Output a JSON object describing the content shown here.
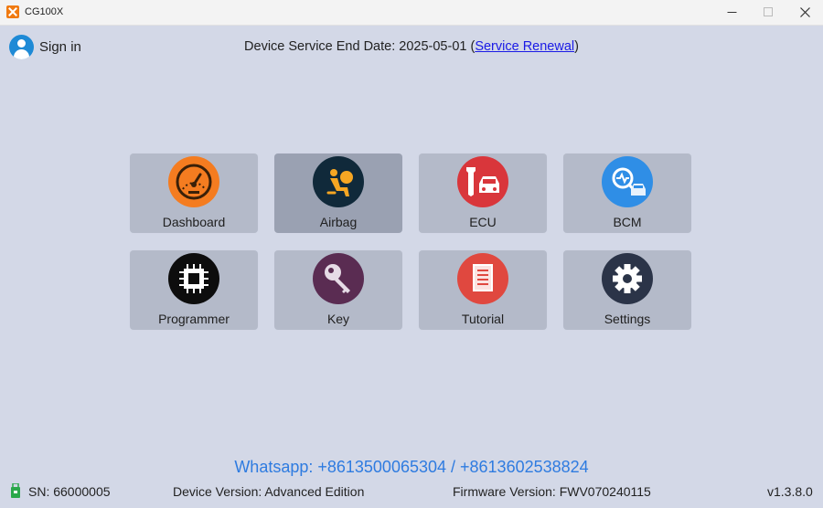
{
  "window": {
    "title": "CG100X",
    "controls": [
      "minimize-icon",
      "maximize-icon",
      "close-icon"
    ]
  },
  "header": {
    "sign_in": "Sign in",
    "service_prefix": "Device Service End Date: 2025-05-01 (",
    "service_link": "Service Renewal",
    "service_suffix": ")"
  },
  "tiles": [
    {
      "label": "Dashboard",
      "icon": "speedometer-icon",
      "color": "#f47c20"
    },
    {
      "label": "Airbag",
      "icon": "airbag-icon",
      "color": "#10293a",
      "selected": true
    },
    {
      "label": "ECU",
      "icon": "wrench-car-icon",
      "color": "#d9363b"
    },
    {
      "label": "BCM",
      "icon": "car-diagnostic-icon",
      "color": "#2f8ee6"
    },
    {
      "label": "Programmer",
      "icon": "chip-icon",
      "color": "#0d0d0d"
    },
    {
      "label": "Key",
      "icon": "key-icon",
      "color": "#5a2c52"
    },
    {
      "label": "Tutorial",
      "icon": "document-icon",
      "color": "#e0483f"
    },
    {
      "label": "Settings",
      "icon": "gear-icon",
      "color": "#2b3448"
    }
  ],
  "contact": "Whatsapp: +8613500065304 / +8613602538824",
  "footer": {
    "sn": "SN: 66000005",
    "device_version": "Device Version: Advanced Edition",
    "firmware_version": "Firmware Version: FWV070240115",
    "app_version": "v1.3.8.0"
  }
}
